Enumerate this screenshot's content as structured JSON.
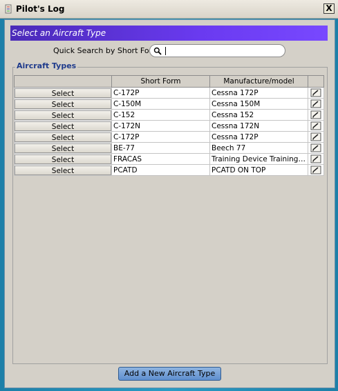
{
  "window": {
    "title": "Pilot's Log",
    "close_glyph": "X"
  },
  "header": {
    "title": "Select an Aircraft Type"
  },
  "search": {
    "label": "Quick Search by Short Form",
    "value": "",
    "icon": "search-icon"
  },
  "group": {
    "title": "Aircraft Types"
  },
  "table": {
    "columns": [
      "",
      "Short Form",
      "Manufacture/model",
      ""
    ],
    "rows": [
      {
        "action": "Select",
        "short_form": "C-172P",
        "model": "Cessna 172P"
      },
      {
        "action": "Select",
        "short_form": "C-150M",
        "model": "Cessna 150M"
      },
      {
        "action": "Select",
        "short_form": "C-152",
        "model": "Cessna 152"
      },
      {
        "action": "Select",
        "short_form": "C-172N",
        "model": "Cessna 172N"
      },
      {
        "action": "Select",
        "short_form": "C-172P",
        "model": "Cessna 172P"
      },
      {
        "action": "Select",
        "short_form": "BE-77",
        "model": "Beech 77"
      },
      {
        "action": "Select",
        "short_form": "FRACAS",
        "model": "Training Device Training D..."
      },
      {
        "action": "Select",
        "short_form": "PCATD",
        "model": "PCATD ON TOP"
      }
    ]
  },
  "footer": {
    "add_label": "Add a New Aircraft Type"
  },
  "colors": {
    "header_band": "#6a3af0",
    "window_frame": "#2a9cc4",
    "group_title": "#1f3b8c"
  }
}
